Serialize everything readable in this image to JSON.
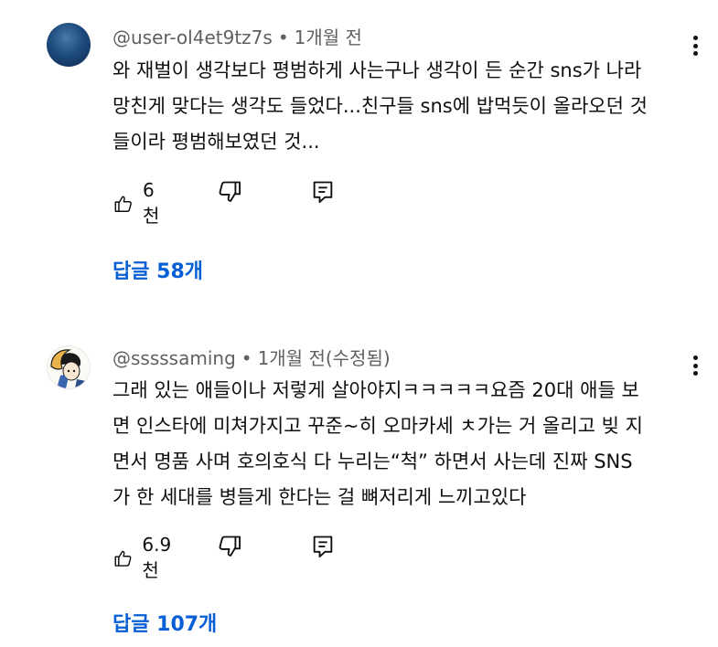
{
  "comments": [
    {
      "username": "@user-ol4et9tz7s",
      "time": "1개월 전",
      "lines": [
        "와 재벌이 생각보다 평범하게 사는구나 생각이 든 순간 sns가 나라",
        "망친게 맞다는 생각도 들었다...친구들 sns에 밥먹듯이 올라오던 것",
        "들이라 평범해보였던 것..."
      ],
      "likes": "6천",
      "replies": "답글 58개"
    },
    {
      "username": "@sssssaming",
      "time": "1개월 전(수정됨)",
      "lines": [
        "그래 있는 애들이나 저렇게 살아야지ㅋㅋㅋㅋㅋ요즘 20대 애들 보",
        "면 인스타에 미쳐가지고 꾸준~히 오마카세 ㅊ가는 거 올리고 빚 지",
        "면서 명품 사며 호의호식 다 누리는“척” 하면서 사는데 진짜 SNS",
        "가 한 세대를 병들게 한다는 걸 뼈저리게 느끼고있다"
      ],
      "likes": "6.9천",
      "replies": "답글 107개"
    }
  ],
  "separator": "•",
  "icons": {
    "like": "thumbs-up-icon",
    "dislike": "thumbs-down-icon",
    "reply": "reply-icon",
    "more": "more-vertical-icon"
  },
  "colors": {
    "link": "#065fd4",
    "meta": "#606060",
    "text": "#0f0f0f"
  }
}
